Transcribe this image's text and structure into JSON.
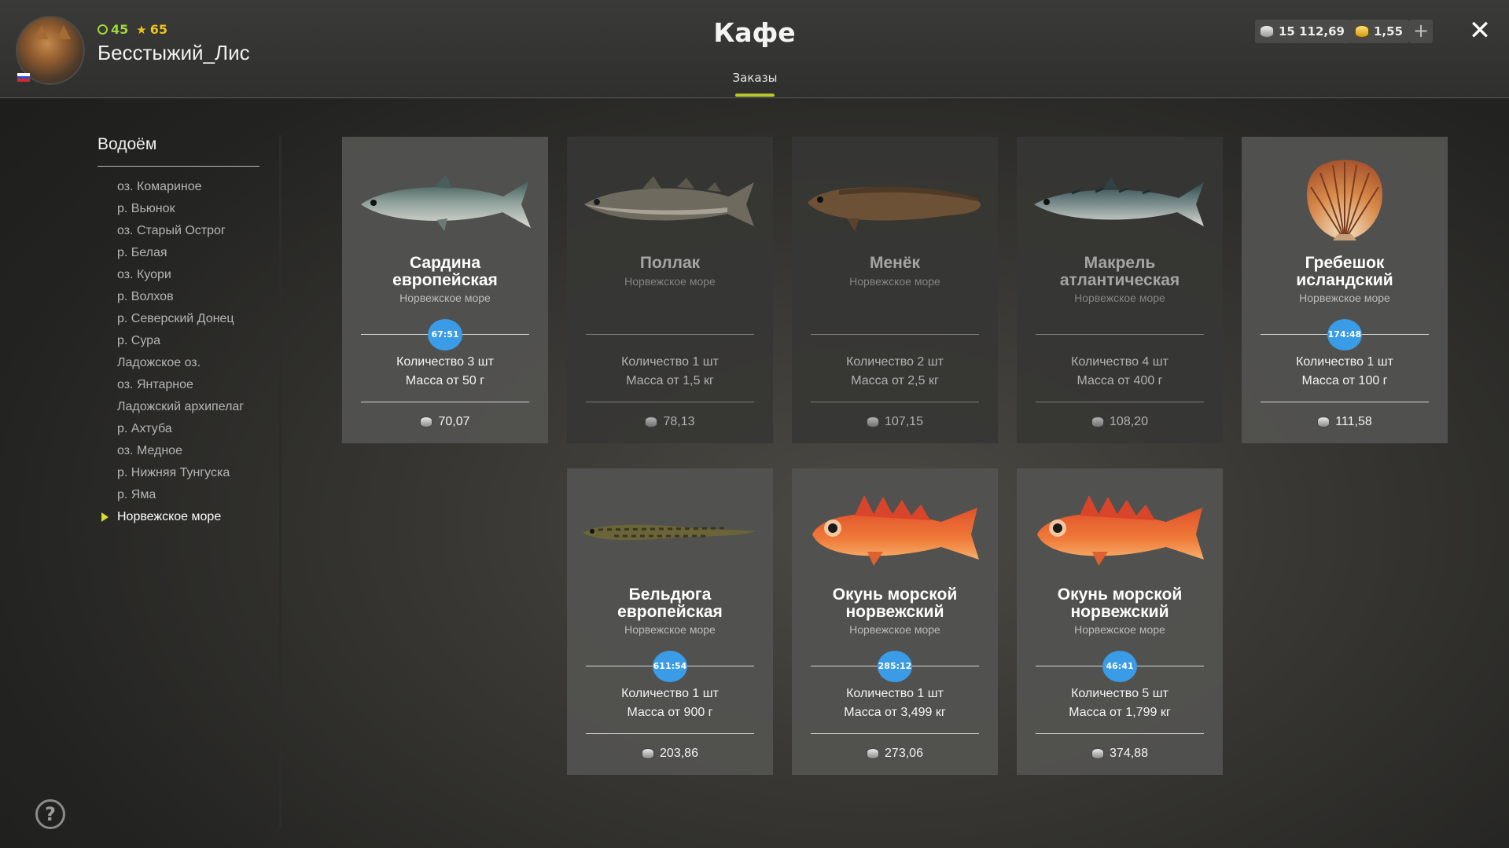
{
  "header": {
    "title": "Кафе",
    "tab_label": "Заказы",
    "player": {
      "level": "45",
      "rank": "65",
      "username": "Бесстыжий_Лис"
    },
    "silver_balance": "15 112,69",
    "gold_balance": "1,55",
    "plus_label": "+",
    "close_label": "✕"
  },
  "colors": {
    "accent": "#b6c82a",
    "timer": "#3a9be6",
    "level": "#9fd83a",
    "rank": "#f1c21b",
    "active_arrow": "#d8dc2e"
  },
  "sidebar": {
    "title": "Водоём",
    "items": [
      "оз. Комариное",
      "р. Вьюнок",
      "оз. Старый Острог",
      "р. Белая",
      "оз. Куори",
      "р. Волхов",
      "р. Северский Донец",
      "р. Сура",
      "Ладожское оз.",
      "оз. Янтарное",
      "Ладожский архипелаг",
      "р. Ахтуба",
      "оз. Медное",
      "р. Нижняя Тунгуска",
      "р. Яма",
      "Норвежское море"
    ],
    "active_index": 15
  },
  "help_label": "?",
  "orders": [
    {
      "icon": "sardine-fish-icon",
      "name_line1": "Сардина",
      "name_line2": "европейская",
      "location": "Норвежское море",
      "timer": "67:51",
      "quantity": "Количество 3 шт",
      "mass": "Масса от 50 г",
      "price": "70,07",
      "active": true
    },
    {
      "icon": "pollock-fish-icon",
      "name_line1": "Поллак",
      "name_line2": "",
      "location": "Норвежское море",
      "timer": "",
      "quantity": "Количество 1 шт",
      "mass": "Масса от 1,5 кг",
      "price": "78,13",
      "active": false
    },
    {
      "icon": "tusk-fish-icon",
      "name_line1": "Менёк",
      "name_line2": "",
      "location": "Норвежское море",
      "timer": "",
      "quantity": "Количество 2 шт",
      "mass": "Масса от 2,5 кг",
      "price": "107,15",
      "active": false
    },
    {
      "icon": "mackerel-fish-icon",
      "name_line1": "Макрель",
      "name_line2": "атлантическая",
      "location": "Норвежское море",
      "timer": "",
      "quantity": "Количество 4 шт",
      "mass": "Масса от 400 г",
      "price": "108,20",
      "active": false
    },
    {
      "icon": "scallop-shell-icon",
      "name_line1": "Гребешок",
      "name_line2": "исландский",
      "location": "Норвежское море",
      "timer": "174:48",
      "quantity": "Количество 1 шт",
      "mass": "Масса от 100 г",
      "price": "111,58",
      "active": true
    },
    {
      "icon": "eelpout-fish-icon",
      "name_line1": "Бельдюга",
      "name_line2": "европейская",
      "location": "Норвежское море",
      "timer": "611:54",
      "quantity": "Количество 1 шт",
      "mass": "Масса от 900 г",
      "price": "203,86",
      "active": true
    },
    {
      "icon": "redfish-icon",
      "name_line1": "Окунь морской",
      "name_line2": "норвежский",
      "location": "Норвежское море",
      "timer": "285:12",
      "quantity": "Количество 1 шт",
      "mass": "Масса от 3,499 кг",
      "price": "273,06",
      "active": true
    },
    {
      "icon": "redfish-icon",
      "name_line1": "Окунь морской",
      "name_line2": "норвежский",
      "location": "Норвежское море",
      "timer": "46:41",
      "quantity": "Количество 5 шт",
      "mass": "Масса от 1,799 кг",
      "price": "374,88",
      "active": true
    }
  ]
}
